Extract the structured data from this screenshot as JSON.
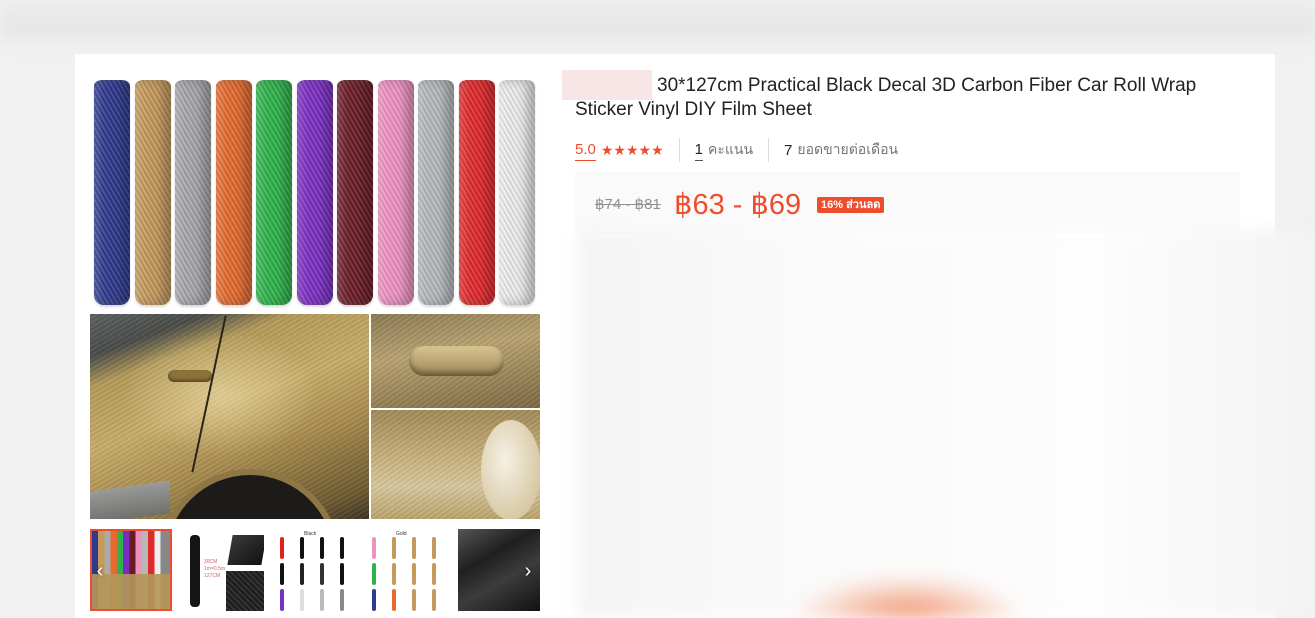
{
  "product": {
    "title": "30*127cm Practical Black Decal 3D Carbon Fiber Car Roll Wrap Sticker Vinyl DIY Film Sheet",
    "rating": "5.0",
    "stars": "★★★★★",
    "rating_count": "1",
    "rating_count_label": "คะแนน",
    "sold_count": "7",
    "sold_label": "ยอดขายต่อเดือน",
    "original_price": "฿74 - ฿81",
    "price": "฿63 - ฿69",
    "discount_badge": "16% ส่วนลด"
  },
  "gallery": {
    "roll_colors": [
      "#2e3a8e",
      "#c59a5c",
      "#a7a7ab",
      "#e56a2f",
      "#2fb34c",
      "#7b2fc3",
      "#6b1c27",
      "#ef92c1",
      "#b6b9bd",
      "#e1292c",
      "#ececec"
    ],
    "thumb_labels": {
      "t2": "30CM\n1m=0.5m\n127CM",
      "t3": "Black",
      "t4": "Gold"
    },
    "prev_icon": "‹",
    "next_icon": "›"
  },
  "colors": {
    "accent": "#ee4d2d",
    "price_bg": "#fafafa"
  }
}
